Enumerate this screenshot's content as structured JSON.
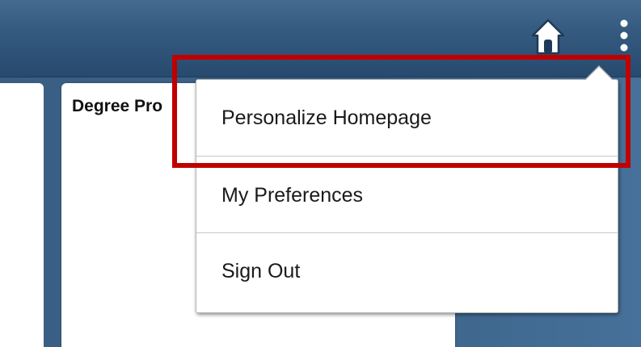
{
  "header": {
    "home_icon": "home-icon",
    "more_icon": "more-vertical-icon"
  },
  "tile": {
    "title": "Degree Pro"
  },
  "menu": {
    "items": [
      {
        "label": "Personalize Homepage"
      },
      {
        "label": "My Preferences"
      },
      {
        "label": "Sign Out"
      }
    ]
  },
  "colors": {
    "header": "#355a80",
    "page": "#3c6489",
    "highlight": "#c00000",
    "menu_bg": "#ffffff"
  }
}
